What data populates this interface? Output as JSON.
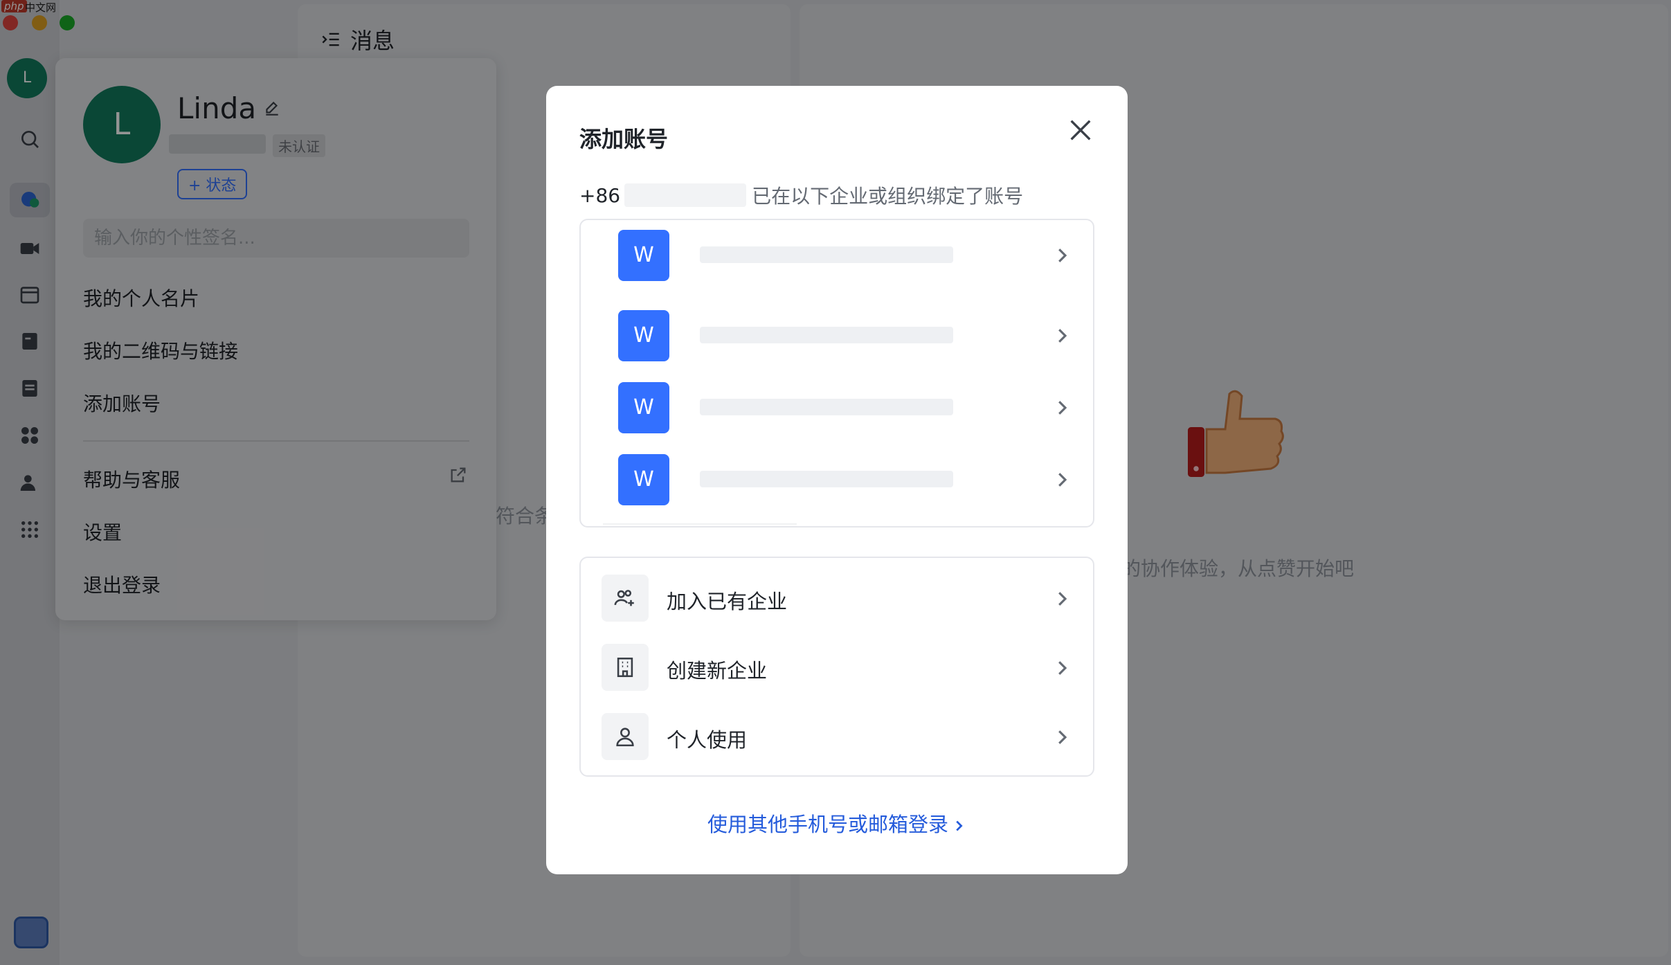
{
  "window": {
    "logo_text_1": "php",
    "logo_text_2": "中文网"
  },
  "sidebar": {
    "avatar_letter": "L"
  },
  "messages_panel": {
    "title": "消息",
    "hint_fragment": "符合条"
  },
  "right_panel": {
    "hint": "的协作体验，从点赞开始吧"
  },
  "profile_menu": {
    "avatar_letter": "L",
    "name": "Linda",
    "verify_badge": "未认证",
    "status_button": "+ 状态",
    "signature_placeholder": "输入你的个性签名...",
    "items": [
      "我的个人名片",
      "我的二维码与链接",
      "添加账号",
      "帮助与客服",
      "设置",
      "退出登录"
    ]
  },
  "modal": {
    "title": "添加账号",
    "phone_prefix": "+86",
    "bound_text": "已在以下企业或组织绑定了账号",
    "orgs": [
      {
        "icon_letter": "W"
      },
      {
        "icon_letter": "W"
      },
      {
        "icon_letter": "W"
      },
      {
        "icon_letter": "W"
      }
    ],
    "actions": [
      {
        "label": "加入已有企业",
        "icon": "join-team-icon"
      },
      {
        "label": "创建新企业",
        "icon": "building-icon"
      },
      {
        "label": "个人使用",
        "icon": "person-icon"
      }
    ],
    "other_login": "使用其他手机号或邮箱登录",
    "colors": {
      "accent": "#3370ff",
      "link": "#245bdb"
    }
  }
}
